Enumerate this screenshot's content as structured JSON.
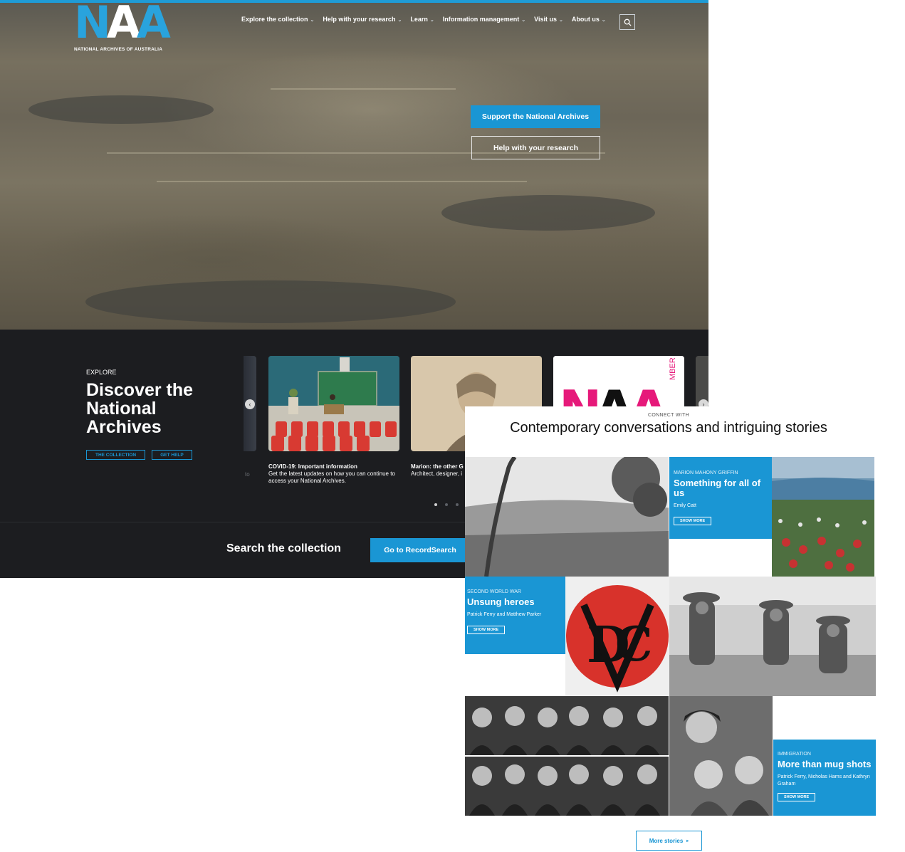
{
  "brand": {
    "logo_text": "NATIONAL ARCHIVES OF AUSTRALIA",
    "accent": "#1a96d4",
    "dark_bg": "#1c1d20"
  },
  "nav": {
    "items": [
      {
        "label": "Explore the collection"
      },
      {
        "label": "Help with your research"
      },
      {
        "label": "Learn"
      },
      {
        "label": "Information management"
      },
      {
        "label": "Visit us"
      },
      {
        "label": "About us"
      }
    ],
    "search_icon": "search-icon"
  },
  "hero": {
    "primary_cta": "Support the National Archives",
    "secondary_cta": "Help with your research"
  },
  "explore": {
    "eyebrow": "EXPLORE",
    "title": "Discover the National Archives",
    "btn_collection": "THE COLLECTION",
    "btn_help": "GET HELP",
    "ghost_text": "to",
    "cards": [
      {
        "title": "COVID-19: Important information",
        "text": "Get the latest updates on how you can continue to access your National Archives."
      },
      {
        "title": "Marion: the other G",
        "text": "Architect, designer, i"
      },
      {
        "title": "",
        "text": ""
      }
    ],
    "card3_side_text": "MBER",
    "carousel_dots": 4
  },
  "search": {
    "title": "Search the collection",
    "button": "Go to RecordSearch"
  },
  "stories": {
    "eyebrow": "CONNECT WITH",
    "title": "Contemporary conversations and intriguing stories",
    "items": [
      {
        "tag": "MARION MAHONY GRIFFIN",
        "title": "Something for all of us",
        "by": "Emily Catt",
        "more": "SHOW MORE"
      },
      {
        "tag": "SECOND WORLD WAR",
        "title": "Unsung heroes",
        "by": "Patrick Ferry and Matthew Parker",
        "more": "SHOW MORE"
      },
      {
        "tag": "IMMIGRATION",
        "title": "More than mug shots",
        "by": "Patrick Ferry, Nicholas Hams and Kathryn Graham",
        "more": "SHOW MORE"
      }
    ],
    "more_stories": "More stories"
  }
}
